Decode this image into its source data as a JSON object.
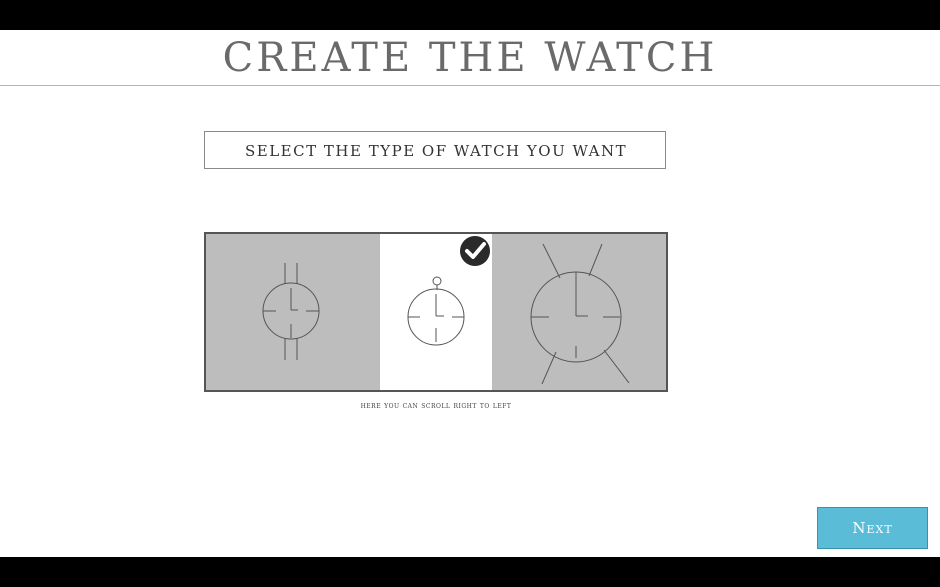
{
  "header": {
    "title": "Create the Watch"
  },
  "instruction": {
    "text": "Select the type of watch you want"
  },
  "carousel": {
    "options": [
      {
        "icon": "wristwatch-icon",
        "selected": false
      },
      {
        "icon": "pocket-watch-icon",
        "selected": true
      },
      {
        "icon": "large-watch-icon",
        "selected": false
      }
    ],
    "hint": "here you can scroll right to left"
  },
  "footer": {
    "next_label": "Next"
  },
  "colors": {
    "accent": "#5bbcd8",
    "panel_bg": "#bdbdbd",
    "selected_bg": "#ffffff",
    "title_text": "#6a6a6a"
  }
}
